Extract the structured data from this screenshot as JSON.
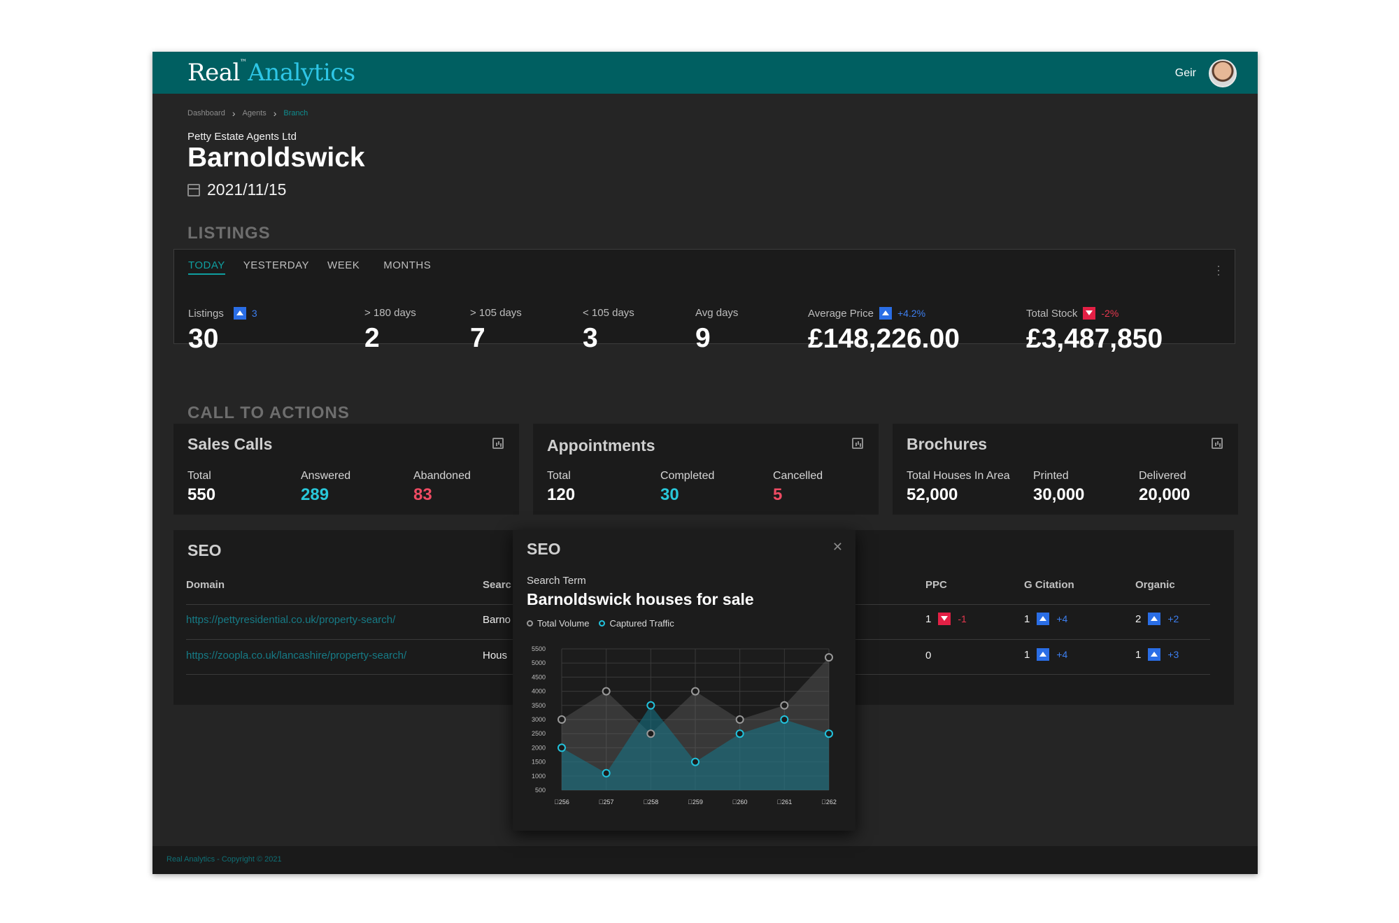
{
  "brand": {
    "logo_word1": "Real",
    "logo_tm": "™",
    "logo_word2": "Analytics"
  },
  "user": {
    "name": "Geir"
  },
  "breadcrumb": [
    "Dashboard",
    "Agents",
    "Branch"
  ],
  "company": "Petty Estate Agents Ltd",
  "branch_title": "Barnoldswick",
  "date": "2021/11/15",
  "listings": {
    "section": "LISTINGS",
    "tabs": [
      "TODAY",
      "YESTERDAY",
      "WEEK",
      "MONTHS"
    ],
    "active_tab": "TODAY",
    "stats": [
      {
        "label": "Listings",
        "value": "30",
        "trend": "up",
        "change": "3"
      },
      {
        "label": "> 180 days",
        "value": "2"
      },
      {
        "label": "> 105 days",
        "value": "7"
      },
      {
        "label": "< 105 days",
        "value": "3"
      },
      {
        "label": "Avg days",
        "value": "9"
      },
      {
        "label": "Average Price",
        "value": "£148,226.00",
        "trend": "up",
        "change": "+4.2%"
      },
      {
        "label": "Total Stock",
        "value": "£3,487,850",
        "trend": "down",
        "change": "-2%"
      }
    ]
  },
  "cta": {
    "section": "CALL TO ACTIONS",
    "cards": [
      {
        "title": "Sales Calls",
        "metrics": [
          {
            "label": "Total",
            "value": "550"
          },
          {
            "label": "Answered",
            "value": "289"
          },
          {
            "label": "Abandoned",
            "value": "83"
          }
        ]
      },
      {
        "title": "Appointments",
        "metrics": [
          {
            "label": "Total",
            "value": "120"
          },
          {
            "label": "Completed",
            "value": "30"
          },
          {
            "label": "Cancelled",
            "value": "5"
          }
        ]
      },
      {
        "title": "Brochures",
        "metrics": [
          {
            "label": "Total Houses In Area",
            "value": "52,000"
          },
          {
            "label": "Printed",
            "value": "30,000"
          },
          {
            "label": "Delivered",
            "value": "20,000"
          }
        ]
      }
    ]
  },
  "seo": {
    "title": "SEO",
    "headers": {
      "domain": "Domain",
      "search": "Searc",
      "ppc": "PPC",
      "gcitation": "G Citation",
      "organic": "Organic"
    },
    "rows": [
      {
        "domain": "https://pettyresidential.co.uk/property-search/",
        "search": "Barno",
        "ppc": "1",
        "ppc_trend": "down",
        "ppc_change": "-1",
        "gcitation": "1",
        "gc_trend": "up",
        "gc_change": "+4",
        "organic": "2",
        "org_trend": "up",
        "org_change": "+2"
      },
      {
        "domain": "https://zoopla.co.uk/lancashire/property-search/",
        "search": "Hous",
        "ppc": "0",
        "gcitation": "1",
        "gc_trend": "up",
        "gc_change": "+4",
        "organic": "1",
        "org_trend": "up",
        "org_change": "+3"
      }
    ]
  },
  "popup": {
    "title": "SEO",
    "close_icon": "close-icon",
    "search_term_label": "Search Term",
    "search_term": "Barnoldswick houses for sale"
  },
  "chart_data": {
    "type": "area",
    "x": [
      "\u0000256",
      "\u0000257",
      "\u0000258",
      "\u0000259",
      "\u0000260",
      "\u0000261",
      "\u0000262"
    ],
    "series": [
      {
        "name": "Total Volume",
        "values": [
          3000,
          4000,
          2500,
          4000,
          3000,
          3500,
          5200
        ],
        "color": "#9a9a9a"
      },
      {
        "name": "Captured Traffic",
        "values": [
          2000,
          1100,
          3500,
          1500,
          2500,
          3000,
          2500
        ],
        "color": "#22c3dd"
      }
    ],
    "yticks": [
      500,
      1000,
      1500,
      2000,
      2500,
      3000,
      3500,
      4000,
      4500,
      5000,
      5500
    ],
    "ylim": [
      500,
      5500
    ],
    "grid": true,
    "legend_position": "top-left"
  },
  "footer": "Real Analytics - Copyright © 2021",
  "colors": {
    "header": "#005f61",
    "accent": "#0f9ea0",
    "up": "#2a6ee6",
    "down": "#e32045",
    "teal_value": "#29c7d9",
    "red_value": "#ef4b63"
  }
}
